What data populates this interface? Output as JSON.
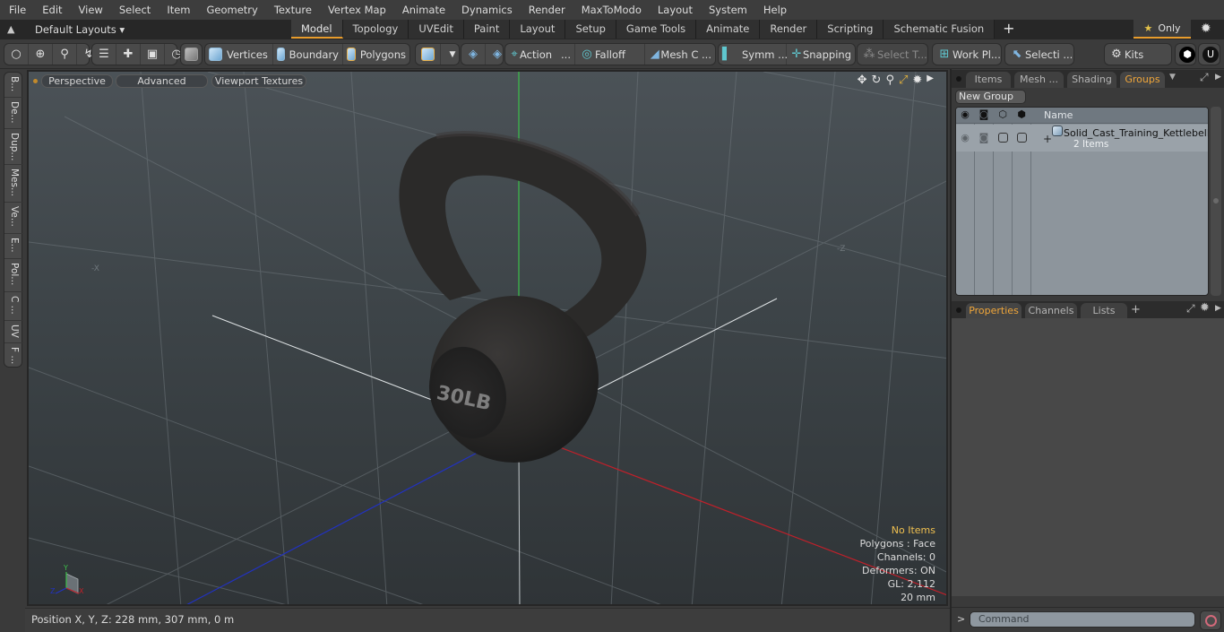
{
  "menubar": {
    "items": [
      "File",
      "Edit",
      "View",
      "Select",
      "Item",
      "Geometry",
      "Texture",
      "Vertex Map",
      "Animate",
      "Dynamics",
      "Render",
      "MaxToModo",
      "Layout",
      "System",
      "Help"
    ]
  },
  "tabbar": {
    "layouts_label": "Default Layouts ▾",
    "tabs": [
      "Model",
      "Topology",
      "UVEdit",
      "Paint",
      "Layout",
      "Setup",
      "Game Tools",
      "Animate",
      "Render",
      "Scripting",
      "Schematic Fusion"
    ],
    "active_tab": "Model",
    "add_tab": "+",
    "only_label": "Only"
  },
  "toolbar": {
    "vertices": "Vertices",
    "boundary": "Boundary",
    "polygons": "Polygons",
    "action": "Action",
    "falloff": "Falloff",
    "mesh_c": "Mesh C ...",
    "symm": "Symm ...",
    "snapping": "Snapping",
    "select_t": "Select T...",
    "work_pl": "Work Pl...",
    "selecti": "Selecti ...",
    "kits": "Kits",
    "ellipsis": "..."
  },
  "left_strip": {
    "items": [
      "B...",
      "De...",
      "Dup...",
      "Mes...",
      "Ve...",
      "E...",
      "Pol...",
      "C ...",
      "UV",
      "F ..."
    ]
  },
  "viewport": {
    "perspective": "Perspective",
    "advanced": "Advanced",
    "textures": "Viewport Textures",
    "model_label": "30LB",
    "axis_labels": {
      "neg_x": "-X",
      "neg_z": "-Z",
      "gizmo_y": "Y",
      "gizmo_x": "X",
      "gizmo_z": "Z"
    },
    "hud": {
      "selection": "No Items",
      "polygons": "Polygons : Face",
      "channels": "Channels: 0",
      "deformers": "Deformers: ON",
      "gl": "GL: 2,112",
      "scale": "20 mm"
    },
    "colors": {
      "x_axis": "#c0202a",
      "y_axis": "#3cbf4a",
      "z_axis": "#2232c0",
      "hud_warn": "#f0c050"
    }
  },
  "statusbar": {
    "position": "Position X, Y, Z:   228 mm, 307 mm, 0 m"
  },
  "right_panel": {
    "top_tabs": [
      "Items",
      "Mesh ...",
      "Shading",
      "Groups"
    ],
    "active_top_tab": "Groups",
    "new_group": "New Group",
    "outliner": {
      "name_header": "Name",
      "rows": [
        {
          "name": "Solid_Cast_Training_Kettlebell...",
          "sub": "2 Items",
          "expand": "+"
        }
      ]
    },
    "bottom_tabs": [
      "Properties",
      "Channels",
      "Lists"
    ],
    "active_bottom_tab": "Properties",
    "add_tab": "+",
    "command_placeholder": "Command",
    "prompt": ">"
  },
  "accent_color": "#e89c2c"
}
